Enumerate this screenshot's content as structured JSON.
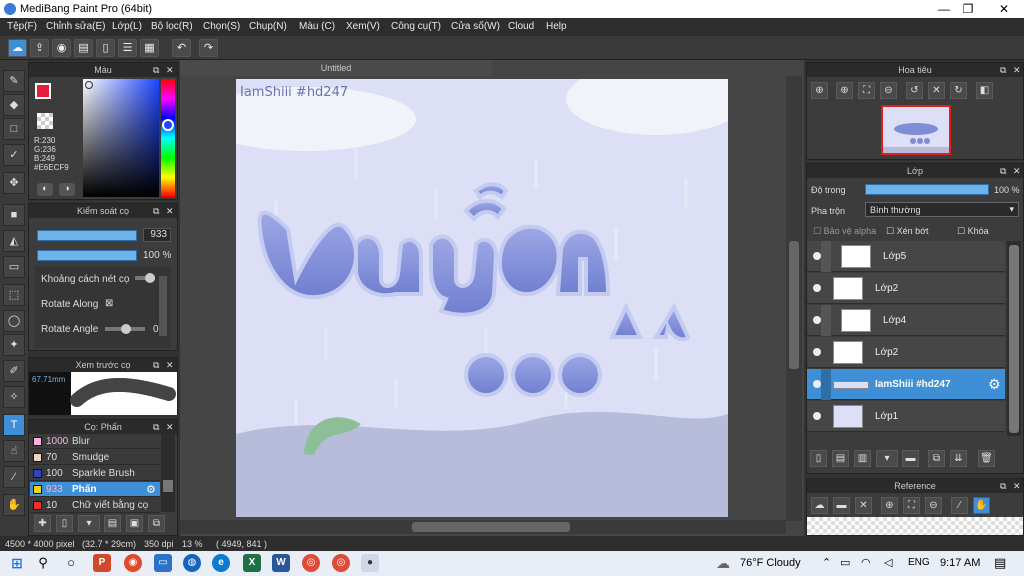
{
  "window": {
    "title": "MediBang Paint Pro (64bit)",
    "min": "—",
    "max": "❐",
    "close": "✕"
  },
  "menu": [
    "Tệp(F)",
    "Chỉnh sửa(E)",
    "Lớp(L)",
    "Bộ lọc(R)",
    "Chọn(S)",
    "Chụp(N)",
    "Màu (C)",
    "Xem(V)",
    "Công cụ(T)",
    "Cửa số(W)",
    "Cloud",
    "Help"
  ],
  "color_panel": {
    "title": "Màu",
    "r": "R:230",
    "g": "G:236",
    "b": "B:249",
    "hex": "#E6ECF9",
    "primary_color": "#e61e3c",
    "secondary_color": "#c9cdf5"
  },
  "brush_control": {
    "title": "Kiểm soát cọ",
    "size": "933",
    "opacity": "100 %",
    "spacing_label": "Khoảng cách nét cọ",
    "rotate_along_label": "Rotate Along",
    "rotate_along_mark": "⊠",
    "rotate_angle_label": "Rotate Angle",
    "rotate_angle_value": "0"
  },
  "brush_preview": {
    "title": "Xem trước cọ",
    "size_label": "67.71mm"
  },
  "brush_list": {
    "title": "Cọ: Phấn",
    "items": [
      {
        "size": "1000",
        "name": "Blur",
        "color": "#f7b3de"
      },
      {
        "size": "70",
        "name": "Smudge",
        "color": "#f2d5be"
      },
      {
        "size": "100",
        "name": "Sparkle Brush",
        "color": "#2e46c6"
      },
      {
        "size": "933",
        "name": "Phấn",
        "color": "#f0d21a",
        "active": true
      },
      {
        "size": "10",
        "name": "Chữ viết bằng cọ",
        "color": "#e63232"
      }
    ]
  },
  "canvas": {
    "tab": "Untitled",
    "watermark": "IamShiii #hd247"
  },
  "navigator": {
    "title": "Hoa tiêu"
  },
  "layer_panel": {
    "title": "Lớp",
    "opacity_label": "Độ trong",
    "opacity_value": "100 %",
    "blend_label": "Pha trộn",
    "blend_value": "Bình thường",
    "protect_alpha": "Bảo vệ alpha",
    "clipping": "Xén bớt",
    "lock": "Khóa",
    "layers": [
      {
        "name": "Lớp5",
        "indent": true
      },
      {
        "name": "Lớp2",
        "indent": false
      },
      {
        "name": "Lớp4",
        "indent": true
      },
      {
        "name": "Lớp2",
        "indent": false
      },
      {
        "name": "IamShiii #hd247",
        "indent": true,
        "active": true
      },
      {
        "name": "Lớp1",
        "indent": false
      }
    ]
  },
  "reference": {
    "title": "Reference"
  },
  "status": {
    "pixels": "4500 * 4000 pixel",
    "cm": "(32.7 * 29cm)",
    "dpi": "350 dpi",
    "zoom": "13 %",
    "coords": "( 4949, 841 )"
  },
  "taskbar": {
    "weather": "76°F  Cloudy",
    "lang": "ENG",
    "time": "9:17 AM"
  }
}
